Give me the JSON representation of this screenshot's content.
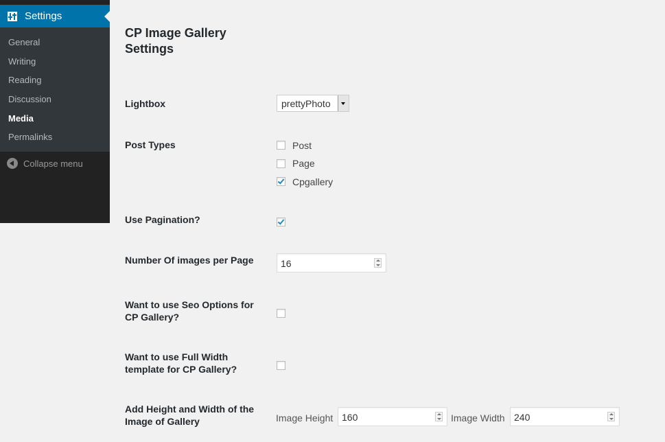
{
  "sidebar": {
    "active_label": "Settings",
    "active_icon": "settings-sliders-icon",
    "items": [
      {
        "label": "General"
      },
      {
        "label": "Writing"
      },
      {
        "label": "Reading"
      },
      {
        "label": "Discussion"
      },
      {
        "label": "Media"
      },
      {
        "label": "Permalinks"
      }
    ],
    "current_item": "Media",
    "collapse_label": "Collapse menu",
    "accent_color": "#0073aa"
  },
  "page": {
    "title": "CP Image Gallery Settings"
  },
  "fields": {
    "lightbox": {
      "label": "Lightbox",
      "selected": "prettyPhoto"
    },
    "post_types": {
      "label": "Post Types",
      "options": [
        {
          "label": "Post",
          "checked": false
        },
        {
          "label": "Page",
          "checked": false
        },
        {
          "label": "Cpgallery",
          "checked": true
        }
      ]
    },
    "pagination": {
      "label": "Use Pagination?",
      "checked": true
    },
    "images_per_page": {
      "label": "Number Of images per Page",
      "value": "16"
    },
    "seo": {
      "label": "Want to use Seo Options for CP Gallery?",
      "checked": false
    },
    "full_width": {
      "label": "Want to use Full Width template for CP Gallery?",
      "checked": false
    },
    "dimensions": {
      "label": "Add Height and Width of the Image of Gallery",
      "height_label": "Image Height",
      "height_value": "160",
      "width_label": "Image Width",
      "width_value": "240"
    }
  }
}
